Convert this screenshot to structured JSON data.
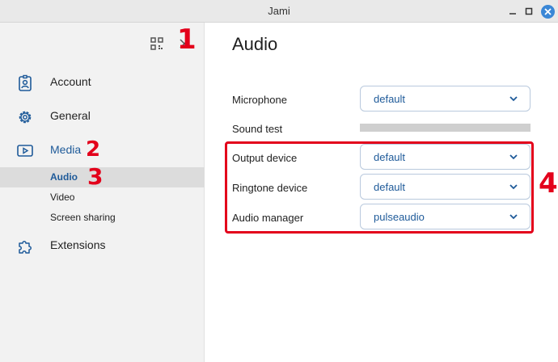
{
  "window": {
    "title": "Jami"
  },
  "sidebar": {
    "items": [
      {
        "label": "Account",
        "icon": "account-badge-icon"
      },
      {
        "label": "General",
        "icon": "gear-icon"
      },
      {
        "label": "Media",
        "icon": "video-icon"
      },
      {
        "label": "Extensions",
        "icon": "puzzle-icon"
      }
    ],
    "media_subitems": [
      {
        "label": "Audio",
        "selected": true
      },
      {
        "label": "Video",
        "selected": false
      },
      {
        "label": "Screen sharing",
        "selected": false
      }
    ]
  },
  "main": {
    "title": "Audio",
    "microphone": {
      "label": "Microphone",
      "value": "default"
    },
    "sound_test": {
      "label": "Sound test",
      "level": 0
    },
    "output_device": {
      "label": "Output device",
      "value": "default"
    },
    "ringtone_device": {
      "label": "Ringtone device",
      "value": "default"
    },
    "audio_manager": {
      "label": "Audio manager",
      "value": "pulseaudio"
    }
  },
  "annotations": [
    "1",
    "2",
    "3",
    "4"
  ],
  "colors": {
    "accent": "#1e5a99",
    "annotation": "#e3001b",
    "close_button": "#3a87d6"
  }
}
